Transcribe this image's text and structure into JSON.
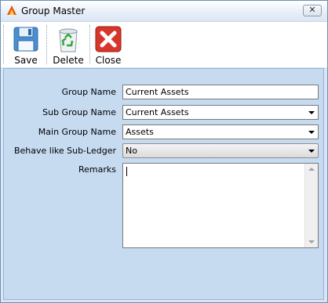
{
  "window": {
    "title": "Group Master",
    "close_glyph": "✕"
  },
  "toolbar": {
    "save_label": "Save",
    "delete_label": "Delete",
    "close_label": "Close"
  },
  "form": {
    "group_name_label": "Group Name",
    "group_name_value": "Current Assets",
    "sub_group_label": "Sub Group Name",
    "sub_group_value": "Current Assets",
    "main_group_label": "Main Group Name",
    "main_group_value": "Assets",
    "behave_label": "Behave like Sub-Ledger",
    "behave_value": "No",
    "remarks_label": "Remarks",
    "remarks_value": ""
  },
  "icons": {
    "app": "app-logo-icon",
    "save": "floppy-disk-icon",
    "delete": "recycle-bin-icon",
    "close": "red-x-icon"
  },
  "colors": {
    "window_bg": "#d8e6f5",
    "panel_bg": "#c6daf0",
    "close_red": "#d9362b"
  }
}
